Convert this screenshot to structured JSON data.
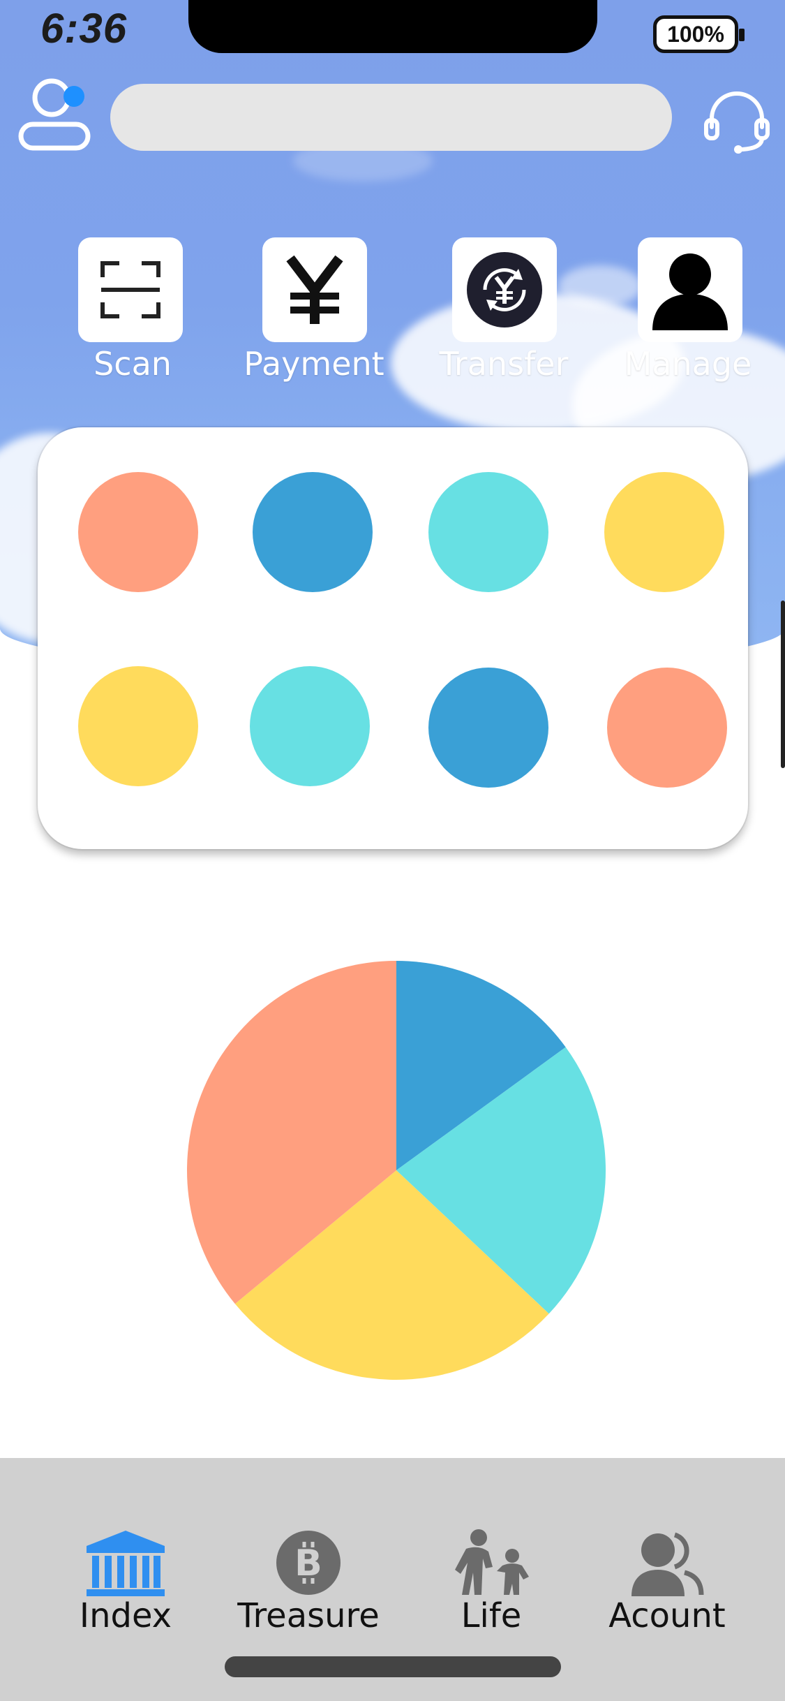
{
  "status_bar": {
    "time": "6:36",
    "battery": "100%"
  },
  "search": {
    "placeholder": ""
  },
  "quick_actions": [
    {
      "label": "Scan",
      "icon": "scan-icon"
    },
    {
      "label": "Payment",
      "icon": "yen-icon"
    },
    {
      "label": "Transfer",
      "icon": "yen-transfer-icon"
    },
    {
      "label": "Manage",
      "icon": "person-icon"
    }
  ],
  "shortcut_colors": {
    "row1": [
      "#ff9f7f",
      "#3aa0d6",
      "#67e0e3",
      "#ffdb5c"
    ],
    "row2": [
      "#ffdb5c",
      "#67e0e3",
      "#3aa0d6",
      "#ff9f7f"
    ]
  },
  "chart_data": {
    "type": "pie",
    "slices": [
      {
        "value": 15,
        "color": "#3aa0d6"
      },
      {
        "value": 22,
        "color": "#67e0e3"
      },
      {
        "value": 27,
        "color": "#ffdb5c"
      },
      {
        "value": 36,
        "color": "#ff9f7f"
      }
    ],
    "start_angle_deg": 0,
    "direction": "clockwise",
    "title": "",
    "legend": "none"
  },
  "bottom_nav": [
    {
      "label": "Index",
      "icon": "bank-icon",
      "active": true,
      "color": "#2f8ff0"
    },
    {
      "label": "Treasure",
      "icon": "bitcoin-icon",
      "active": false,
      "color": "#6b6b6b"
    },
    {
      "label": "Life",
      "icon": "family-icon",
      "active": false,
      "color": "#6b6b6b"
    },
    {
      "label": "Acount",
      "icon": "users-icon",
      "active": false,
      "color": "#6b6b6b"
    }
  ]
}
